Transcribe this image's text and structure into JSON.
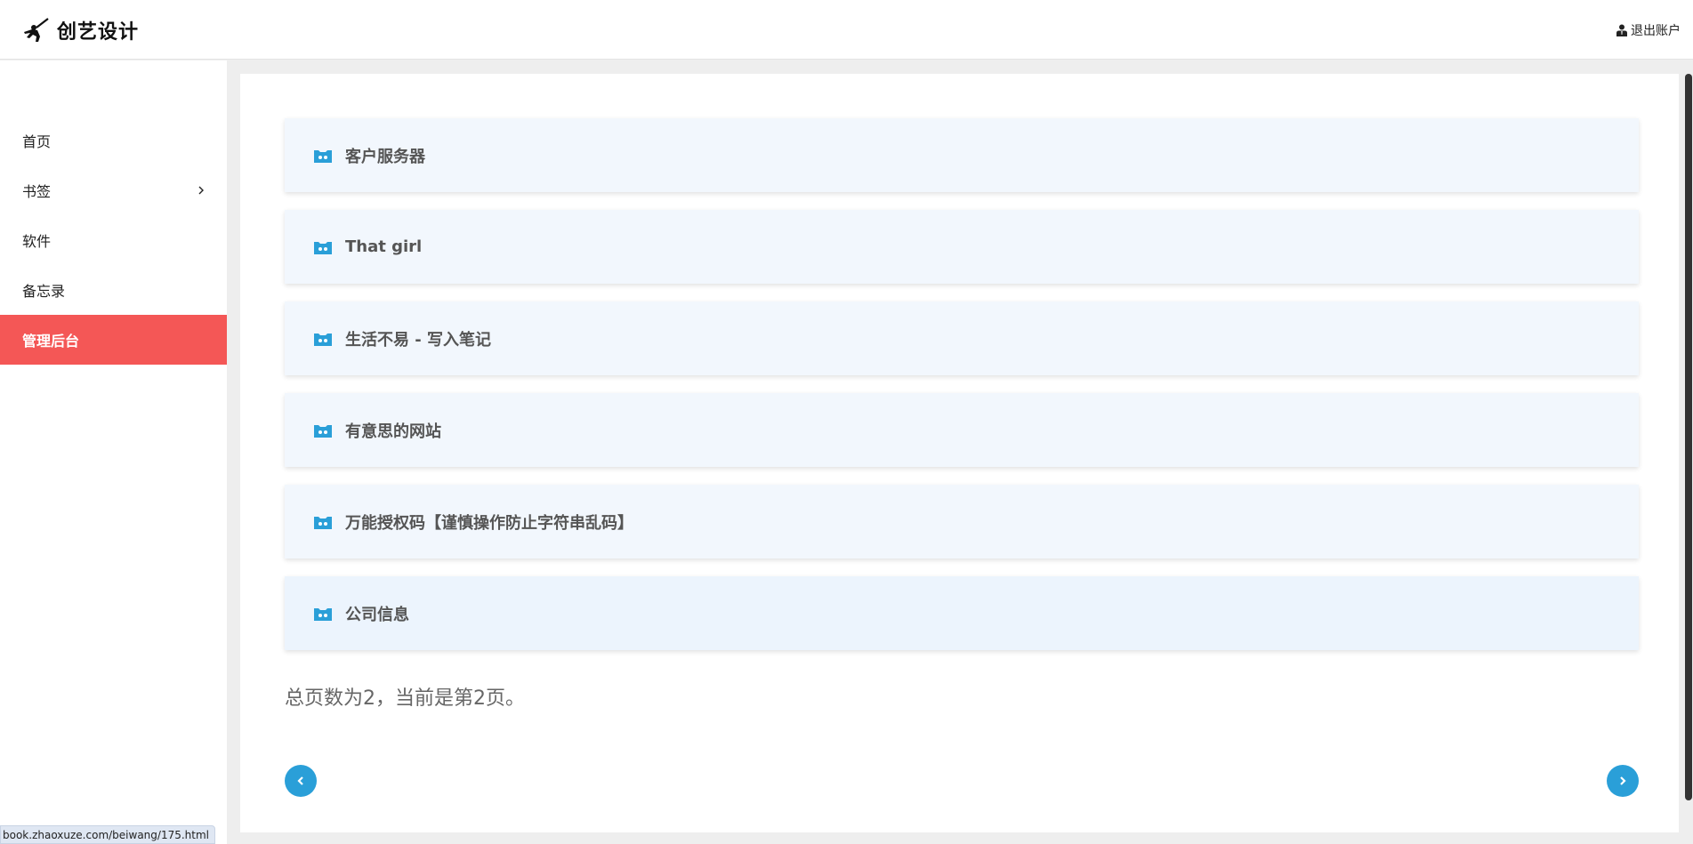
{
  "header": {
    "brand_name": "创艺设计",
    "logo_icon": "fencer-logo-icon",
    "logout_label": "退出账户",
    "logout_icon": "user-icon"
  },
  "sidebar": {
    "items": [
      {
        "label": "首页",
        "active": false
      },
      {
        "label": "书签",
        "active": false,
        "has_submenu": true
      },
      {
        "label": "软件",
        "active": false
      },
      {
        "label": "备忘录",
        "active": false
      },
      {
        "label": "管理后台",
        "active": true
      }
    ],
    "active_color": "#f45756"
  },
  "main": {
    "item_icon": "bot-folder-icon",
    "accent_color": "#2a9fd8",
    "items": [
      {
        "title": "客户服务器"
      },
      {
        "title": "That girl"
      },
      {
        "title": "生活不易 - 写入笔记"
      },
      {
        "title": "有意思的网站"
      },
      {
        "title": "万能授权码【谨慎操作防止字符串乱码】"
      },
      {
        "title": "公司信息"
      }
    ],
    "pagination": {
      "info": "总页数为2，当前是第2页。",
      "total_pages": 2,
      "current_page": 2
    }
  },
  "status_bar": {
    "url": "book.zhaoxuze.com/beiwang/175.html"
  }
}
